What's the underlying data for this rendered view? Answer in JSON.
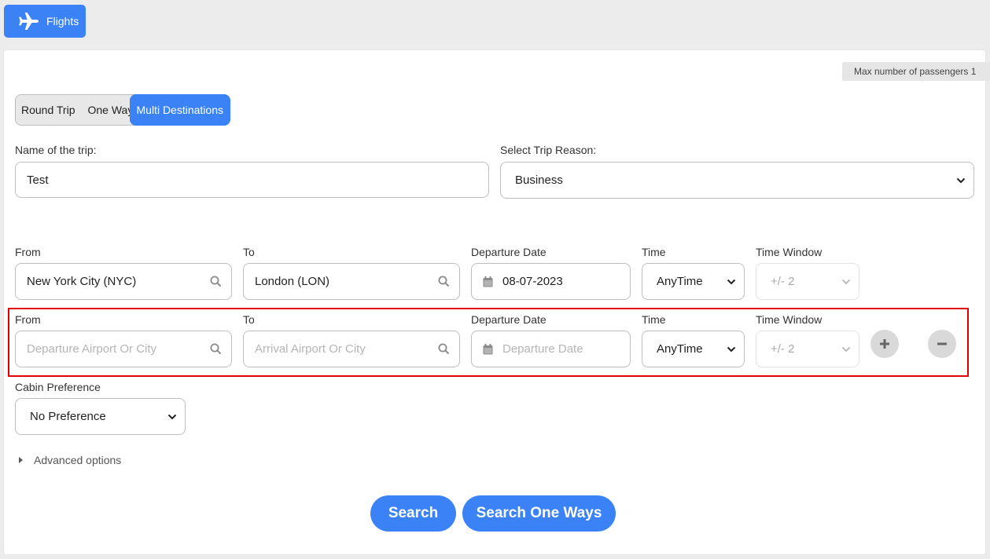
{
  "header": {
    "tab_label": "Flights"
  },
  "max_passengers": "Max number of passengers 1",
  "trip_types": [
    {
      "label": "Round Trip",
      "active": false
    },
    {
      "label": "One Way",
      "active": false
    },
    {
      "label": "Multi Destinations",
      "active": true
    }
  ],
  "trip_name": {
    "label": "Name of the trip:",
    "value": "Test"
  },
  "trip_reason": {
    "label": "Select Trip Reason:",
    "value": "Business"
  },
  "legs": [
    {
      "from_label": "From",
      "from_value": "New York City (NYC)",
      "from_placeholder": "",
      "to_label": "To",
      "to_value": "London (LON)",
      "to_placeholder": "",
      "date_label": "Departure Date",
      "date_value": "08-07-2023",
      "date_placeholder": "",
      "time_label": "Time",
      "time_value": "AnyTime",
      "window_label": "Time Window",
      "window_value": "+/- 2"
    },
    {
      "from_label": "From",
      "from_value": "",
      "from_placeholder": "Departure Airport Or City",
      "to_label": "To",
      "to_value": "",
      "to_placeholder": "Arrival Airport Or City",
      "date_label": "Departure Date",
      "date_value": "",
      "date_placeholder": "Departure Date",
      "time_label": "Time",
      "time_value": "AnyTime",
      "window_label": "Time Window",
      "window_value": "+/- 2"
    }
  ],
  "cabin": {
    "label": "Cabin Preference",
    "value": "No Preference"
  },
  "advanced_options": "Advanced options",
  "buttons": {
    "search": "Search",
    "search_one_ways": "Search One Ways"
  },
  "colors": {
    "primary": "#3b82f6",
    "highlight": "#e00000",
    "background": "#ececec"
  }
}
